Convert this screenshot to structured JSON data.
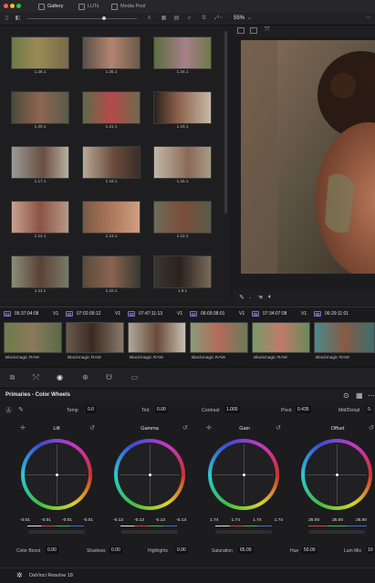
{
  "topbar": {
    "tabs": [
      {
        "label": "Gallery",
        "active": true
      },
      {
        "label": "LUTs",
        "active": false
      },
      {
        "label": "Media Pool",
        "active": false
      }
    ],
    "zoom": "55%"
  },
  "gallery": {
    "stills": [
      {
        "label": "1.26.1"
      },
      {
        "label": "1.25.1"
      },
      {
        "label": "1.24.1"
      },
      {
        "label": "1.20.1"
      },
      {
        "label": "1.21.1"
      },
      {
        "label": "1.19.1"
      },
      {
        "label": "1.17.1"
      },
      {
        "label": "1.16.1"
      },
      {
        "label": "1.15.1"
      },
      {
        "label": "1.14.1"
      },
      {
        "label": "1.13.1"
      },
      {
        "label": "1.12.1"
      },
      {
        "label": "1.11.1"
      },
      {
        "label": "1.10.1"
      },
      {
        "label": "1.9.1"
      }
    ]
  },
  "timeline": {
    "clips": [
      {
        "num": "01",
        "tc": "06:37:04:08",
        "track": "V1",
        "codec": "Blackmagic RAW"
      },
      {
        "num": "02",
        "tc": "07:02:09:12",
        "track": "V1",
        "codec": "Blackmagic RAW"
      },
      {
        "num": "03",
        "tc": "07:47:11:13",
        "track": "V1",
        "codec": "Blackmagic RAW"
      },
      {
        "num": "04",
        "tc": "06:09:38:01",
        "track": "V1",
        "codec": "Blackmagic RAW"
      },
      {
        "num": "05",
        "tc": "07:34:07:08",
        "track": "V1",
        "codec": "Blackmagic RAW"
      },
      {
        "num": "06",
        "tc": "06:29:11:01",
        "track": "V1",
        "codec": "Blackmagic RAW"
      }
    ]
  },
  "primaries": {
    "title": "Primaries - Color Wheels",
    "temp_label": "Temp",
    "temp": "0.0",
    "tint_label": "Tint",
    "tint": "0.00",
    "contrast_label": "Contrast",
    "contrast": "1.000",
    "pivot_label": "Pivot",
    "pivot": "0.435",
    "middetail_label": "Mid/Detail",
    "middetail": "0.",
    "wheels": [
      {
        "name": "Lift",
        "values": [
          "-0.01",
          "-0.01",
          "-0.01",
          "-0.01"
        ]
      },
      {
        "name": "Gamma",
        "values": [
          "-0.13",
          "-0.13",
          "-0.13",
          "-0.13"
        ]
      },
      {
        "name": "Gain",
        "values": [
          "1.74",
          "1.74",
          "1.74",
          "1.74"
        ]
      },
      {
        "name": "Offset",
        "values": [
          "25.00",
          "25.00",
          "25.00"
        ]
      }
    ],
    "color_boost_label": "Color Boost",
    "color_boost": "0.00",
    "shadows_label": "Shadows",
    "shadows": "0.00",
    "highlights_label": "Highlights",
    "highlights": "0.00",
    "saturation_label": "Saturation",
    "saturation": "65.00",
    "hue_label": "Hue",
    "hue": "50.00",
    "lummix_label": "Lum Mix",
    "lummix": "10"
  },
  "status": {
    "app": "DaVinci Resolve 18"
  },
  "colors": {
    "accent": "#7d6cd8",
    "bg": "#1c1c1e"
  }
}
